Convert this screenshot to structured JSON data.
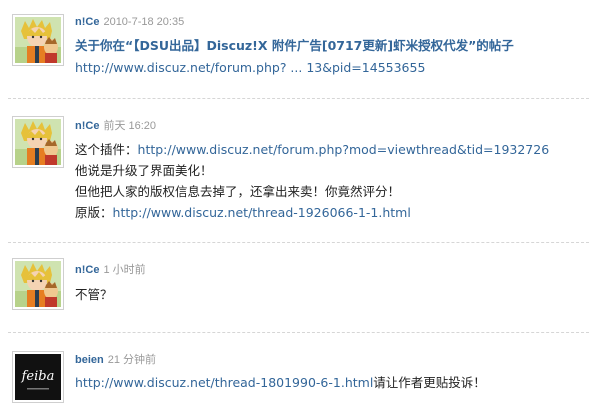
{
  "posts": [
    {
      "author": "n!Ce",
      "time": "2010-7-18 20:35",
      "avatar": "anime-character-avatar",
      "title": "关于你在“【DSU出品】Discuz!X 附件广告[0717更新]虾米授权代发”的帖子",
      "link": "http://www.discuz.net/forum.php? ... 13&pid=14553655"
    },
    {
      "author": "n!Ce",
      "time": "前天 16:20",
      "avatar": "anime-character-avatar",
      "line1_prefix": "这个插件：",
      "line1_link": "http://www.discuz.net/forum.php?mod=viewthread&tid=1932726",
      "line2": "他说是升级了界面美化！",
      "line3": "但他把人家的版权信息去掉了，还拿出来卖！你竟然评分！",
      "line4_prefix": "原版：",
      "line4_link": "http://www.discuz.net/thread-1926066-1-1.html"
    },
    {
      "author": "n!Ce",
      "time": "1 小时前",
      "avatar": "anime-character-avatar",
      "text": "不管？"
    },
    {
      "author": "beien",
      "time": "21 分钟前",
      "avatar": "feiba-logo-avatar",
      "avatar_text": "feiba",
      "link": "http://www.discuz.net/thread-1801990-6-1.html",
      "suffix": "请让作者更贴投诉！"
    }
  ],
  "colors": {
    "link": "#336699",
    "time": "#999999",
    "text": "#222222"
  }
}
